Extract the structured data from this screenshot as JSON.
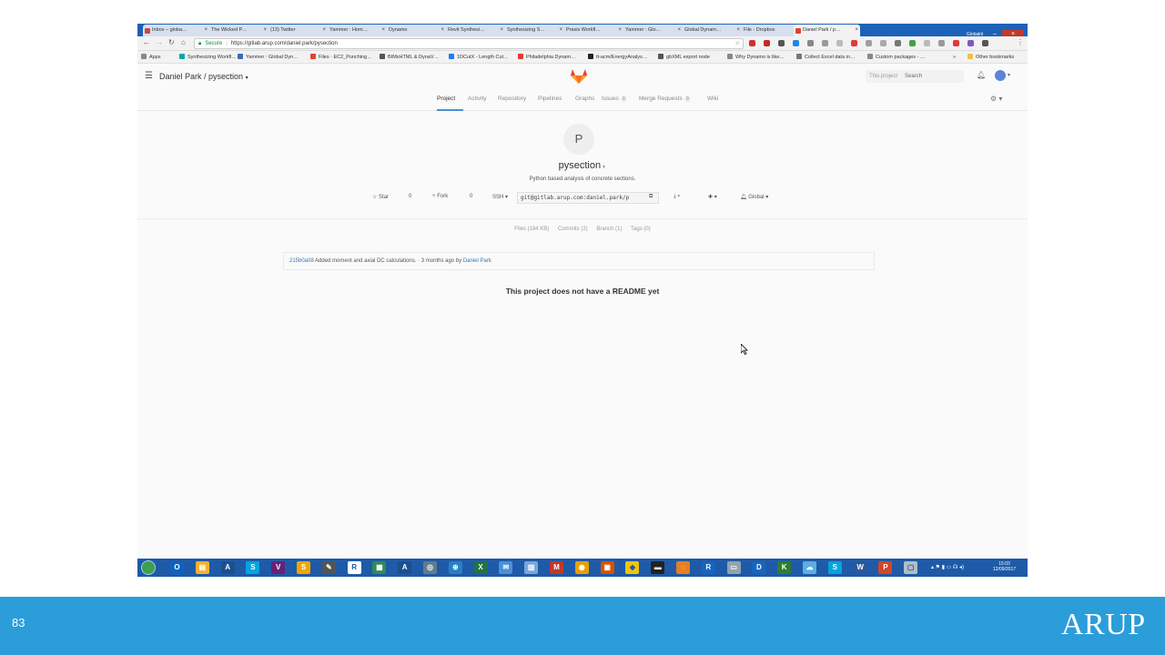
{
  "browser": {
    "tabs": [
      {
        "label": "Inbox – globa…",
        "color": "#d44638",
        "active": false
      },
      {
        "label": "The Wicked P…",
        "color": "#333333",
        "active": false
      },
      {
        "label": "(13) Twitter",
        "color": "#1da1f2",
        "active": false
      },
      {
        "label": "Yammer : Hom…",
        "color": "#3a6bb5",
        "active": false
      },
      {
        "label": "Dynamo",
        "color": "#8e8e8e",
        "active": false
      },
      {
        "label": "Revit Synthesi…",
        "color": "#e53935",
        "active": false
      },
      {
        "label": "Synthesizing S…",
        "color": "#0aa",
        "active": false
      },
      {
        "label": "Praxis Workfl…",
        "color": "#888888",
        "active": false
      },
      {
        "label": "Yammer : Glo…",
        "color": "#3a6bb5",
        "active": false
      },
      {
        "label": "Global Dynam…",
        "color": "#444444",
        "active": false
      },
      {
        "label": "File - Dropbox",
        "color": "#1f7cf2",
        "active": false
      },
      {
        "label": "Daniel Park / p…",
        "color": "#e24329",
        "active": true
      }
    ],
    "window_user": "Globalnl",
    "url": "https://gitlab.arup.com/daniel.park/pysection",
    "secure_label": "Secure",
    "bookmarks": [
      {
        "label": "Apps",
        "color": "#888888"
      },
      {
        "label": "Synthesizing Workfl…",
        "color": "#0aa"
      },
      {
        "label": "Yammer : Global Dyn…",
        "color": "#3a6bb5"
      },
      {
        "label": "Files · EC2_Punching…",
        "color": "#e24329"
      },
      {
        "label": "BIMxHTML & DynaV…",
        "color": "#555555"
      },
      {
        "label": "1DCutX - Length Cut…",
        "color": "#1f7cf2"
      },
      {
        "label": "Philadelphia Dynam…",
        "color": "#e53935"
      },
      {
        "label": "tt-acm/EnergyAnalys…",
        "color": "#222222"
      },
      {
        "label": "gbXML export node",
        "color": "#555555"
      },
      {
        "label": "Why Dynamo is like…",
        "color": "#888888"
      },
      {
        "label": "Collect Excel data in…",
        "color": "#777777"
      },
      {
        "label": "Custom packages - …",
        "color": "#888888"
      },
      {
        "label": "Other bookmarks",
        "color": "#f0c040"
      }
    ]
  },
  "gitlab": {
    "breadcrumb": "Daniel Park / pysection",
    "search_scope": "This project",
    "search_placeholder": "Search",
    "nav": [
      {
        "label": "Project",
        "count": null,
        "active": true
      },
      {
        "label": "Activity",
        "count": null,
        "active": false
      },
      {
        "label": "Repository",
        "count": null,
        "active": false
      },
      {
        "label": "Pipelines",
        "count": null,
        "active": false
      },
      {
        "label": "Graphs",
        "count": null,
        "active": false
      },
      {
        "label": "Issues",
        "count": "0",
        "active": false
      },
      {
        "label": "Merge Requests",
        "count": "0",
        "active": false
      },
      {
        "label": "Wiki",
        "count": null,
        "active": false
      }
    ],
    "project": {
      "avatar_letter": "P",
      "name": "pysection",
      "visibility_icon": "shield-icon",
      "description": "Python based analysis of concrete sections."
    },
    "actions": {
      "star_label": "Star",
      "star_count": "0",
      "fork_label": "Fork",
      "fork_count": "0",
      "protocol": "SSH",
      "clone_url": "git@gitlab.arup.com:daniel.park/p",
      "notification": "Global"
    },
    "stats": {
      "files": "Files (184 KB)",
      "commits": "Commits (2)",
      "branch": "Branch (1)",
      "tags": "Tags (0)"
    },
    "last_commit": {
      "sha": "215b0a08",
      "message": "Added moment and axial DC calculations. · 3 months ago by",
      "author": "Daniel Park"
    },
    "readme_message": "This project does not have a README yet"
  },
  "taskbar": {
    "apps": [
      {
        "glyph": "O",
        "color": "#0b64c0"
      },
      {
        "glyph": "▤",
        "color": "#f2b134"
      },
      {
        "glyph": "A",
        "color": "#1c4f91"
      },
      {
        "glyph": "S",
        "color": "#00a5e0"
      },
      {
        "glyph": "V",
        "color": "#68217a"
      },
      {
        "glyph": "S",
        "color": "#f0a500"
      },
      {
        "glyph": "✎",
        "color": "#555555"
      },
      {
        "glyph": "R",
        "color": "#ffffff"
      },
      {
        "glyph": "▦",
        "color": "#2e8b57"
      },
      {
        "glyph": "A",
        "color": "#1c4f91"
      },
      {
        "glyph": "◎",
        "color": "#607d8b"
      },
      {
        "glyph": "⊕",
        "color": "#2a7fc1"
      },
      {
        "glyph": "X",
        "color": "#217346"
      },
      {
        "glyph": "✉",
        "color": "#4a90d9"
      },
      {
        "glyph": "▥",
        "color": "#7aa7d8"
      },
      {
        "glyph": "M",
        "color": "#c0392b"
      },
      {
        "glyph": "◉",
        "color": "#e8a000"
      },
      {
        "glyph": "▣",
        "color": "#d35400"
      },
      {
        "glyph": "◆",
        "color": "#f1c40f"
      },
      {
        "glyph": "▬",
        "color": "#222222"
      },
      {
        "glyph": "◌",
        "color": "#e67e22"
      },
      {
        "glyph": "R",
        "color": "#1565c0"
      },
      {
        "glyph": "▭",
        "color": "#90a4ae"
      },
      {
        "glyph": "D",
        "color": "#1565c0"
      },
      {
        "glyph": "K",
        "color": "#2e7d32"
      },
      {
        "glyph": "☁",
        "color": "#5dade2"
      },
      {
        "glyph": "S",
        "color": "#00a5e0"
      },
      {
        "glyph": "W",
        "color": "#2b579a"
      },
      {
        "glyph": "P",
        "color": "#d24726"
      },
      {
        "glyph": "▢",
        "color": "#b0bec5"
      }
    ],
    "time": "15:03",
    "date": "12/09/2017"
  },
  "slide": {
    "number": "83",
    "logo": "ARUP",
    "footer_color": "#2b9dd8"
  }
}
